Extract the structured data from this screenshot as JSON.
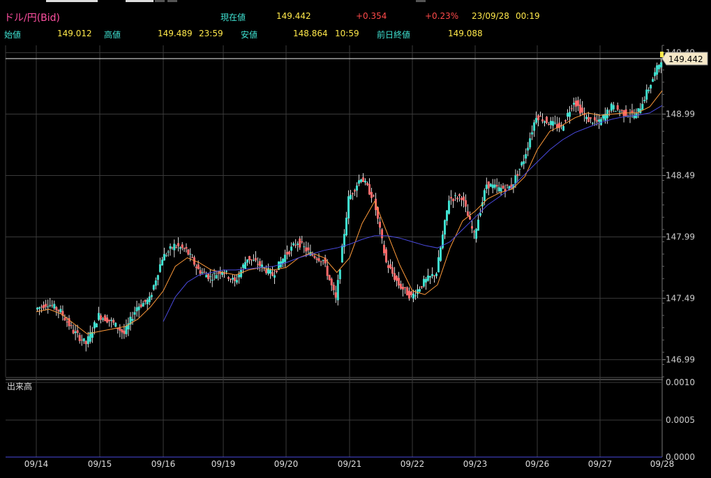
{
  "header": {
    "symbol": "ドル/円(Bid)",
    "current_label": "現在値",
    "current_value": "149.442",
    "change": "+0.354",
    "change_pct": "+0.23%",
    "date": "23/09/28",
    "time": "00:19",
    "open_label": "始値",
    "open_value": "149.012",
    "high_label": "高値",
    "high_value": "149.489",
    "high_time": "23:59",
    "low_label": "安値",
    "low_value": "148.864",
    "low_time": "10:59",
    "prev_close_label": "前日終値",
    "prev_close_value": "149.088"
  },
  "colors": {
    "symbol": "#ff4fa0",
    "label": "#3fe0d0",
    "value": "#ffe84a",
    "change": "#ff4a4a",
    "up_candle": "#3fe0d0",
    "down_candle": "#ff6a6a",
    "ma_short": "#ff9a3a",
    "ma_long": "#4a4adf",
    "grid": "#3a3a3a"
  },
  "chart_data": {
    "type": "line",
    "title": "ドル/円(Bid)",
    "x_tick_labels": [
      "09/14",
      "09/15",
      "09/16",
      "09/19",
      "09/20",
      "09/21",
      "09/22",
      "09/23",
      "09/26",
      "09/27",
      "09/28"
    ],
    "y_tick_labels": [
      "149.49",
      "148.99",
      "148.49",
      "147.99",
      "147.49",
      "146.99"
    ],
    "ylim": [
      146.85,
      149.55
    ],
    "current_price_label": "149.442",
    "grid": true,
    "series": [
      {
        "x": [
          0,
          0.2,
          0.4,
          0.6,
          0.8,
          1.0,
          1.2,
          1.4,
          1.6,
          1.8,
          2.0,
          2.2,
          2.4,
          2.6,
          2.8,
          3.0,
          3.2,
          3.4,
          3.6,
          3.8,
          4.0,
          4.2,
          4.4,
          4.6,
          4.8,
          5.0,
          5.2,
          5.4,
          5.6,
          5.8,
          6.0,
          6.2,
          6.4,
          6.6,
          6.8,
          7.0,
          7.2,
          7.4,
          7.6,
          7.8,
          8.0,
          8.2,
          8.4,
          8.6,
          8.8,
          9.0,
          9.2,
          9.4,
          9.6,
          9.8,
          10.0
        ],
        "values": [
          147.4,
          147.45,
          147.38,
          147.22,
          147.12,
          147.35,
          147.3,
          147.2,
          147.42,
          147.48,
          147.82,
          147.92,
          147.88,
          147.72,
          147.66,
          147.72,
          147.62,
          147.82,
          147.76,
          147.68,
          147.84,
          147.95,
          147.85,
          147.8,
          147.48,
          148.3,
          148.48,
          148.3,
          147.78,
          147.6,
          147.5,
          147.62,
          147.7,
          148.3,
          148.32,
          148.0,
          148.42,
          148.38,
          148.4,
          148.62,
          148.98,
          148.92,
          148.88,
          149.1,
          148.95,
          148.92,
          149.05,
          149.0,
          148.98,
          149.2,
          149.44
        ]
      }
    ],
    "ma_short_values": [
      147.38,
      147.4,
      147.36,
      147.28,
      147.2,
      147.22,
      147.24,
      147.26,
      147.32,
      147.42,
      147.55,
      147.75,
      147.82,
      147.78,
      147.72,
      147.7,
      147.68,
      147.72,
      147.74,
      147.72,
      147.74,
      147.82,
      147.86,
      147.82,
      147.7,
      147.82,
      148.1,
      148.28,
      148.02,
      147.76,
      147.55,
      147.52,
      147.6,
      147.9,
      148.12,
      148.2,
      148.3,
      148.35,
      148.38,
      148.48,
      148.7,
      148.85,
      148.9,
      148.96,
      149.0,
      148.98,
      148.99,
      149.0,
      149.0,
      149.05,
      149.18
    ],
    "ma_long_values": [
      null,
      null,
      null,
      null,
      null,
      null,
      null,
      null,
      null,
      null,
      147.3,
      147.5,
      147.62,
      147.68,
      147.7,
      147.72,
      147.72,
      147.73,
      147.74,
      147.75,
      147.78,
      147.82,
      147.85,
      147.88,
      147.9,
      147.93,
      147.97,
      148.0,
      148.0,
      147.98,
      147.95,
      147.92,
      147.9,
      147.95,
      148.05,
      148.15,
      148.25,
      148.32,
      148.4,
      148.5,
      148.6,
      148.7,
      148.78,
      148.84,
      148.88,
      148.92,
      148.95,
      148.97,
      148.98,
      149.0,
      149.06
    ],
    "volume_label": "出来高",
    "volume_y_tick_labels": [
      "0.0010",
      "0.0005",
      "0.0000"
    ]
  }
}
